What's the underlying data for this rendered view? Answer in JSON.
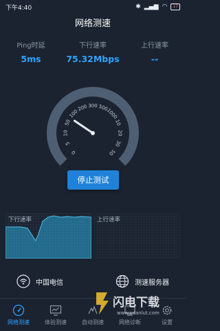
{
  "status_bar": {
    "time": "下午4:40",
    "battery": "17"
  },
  "header": {
    "title": "网络测速"
  },
  "metrics": [
    {
      "label": "Ping时延",
      "value": "5ms"
    },
    {
      "label": "下行速率",
      "value": "75.32Mbps"
    },
    {
      "label": "上行速率",
      "value": "--"
    }
  ],
  "gauge": {
    "ticks": [
      "0",
      "5",
      "10",
      "50",
      "100",
      "200",
      "300",
      "500",
      "1000",
      "10",
      "20",
      "30",
      "50"
    ],
    "needle_value_mbps": 75.32
  },
  "stop_button": {
    "label": "停止测试"
  },
  "graphs": {
    "download_label": "下行速率",
    "upload_label": "上行速率"
  },
  "info": {
    "carrier": "中国电信",
    "server_label": "测速服务器"
  },
  "tabs": [
    {
      "label": "网络测速",
      "icon": "speedometer-icon",
      "active": true
    },
    {
      "label": "体验测速",
      "icon": "monitor-chart-icon",
      "active": false
    },
    {
      "label": "自动测速",
      "icon": "auto-test-icon",
      "active": false
    },
    {
      "label": "网络诊断",
      "icon": "diagnosis-icon",
      "active": false
    },
    {
      "label": "设置",
      "icon": "gear-icon",
      "active": false
    }
  ],
  "watermark": {
    "text": "闪电下载",
    "url_text": "www.sdanlut.com"
  },
  "colors": {
    "background": "#1b2330",
    "accent": "#2fa3ff",
    "button": "#1f82d8",
    "gauge_arc": "#4f5f73"
  }
}
